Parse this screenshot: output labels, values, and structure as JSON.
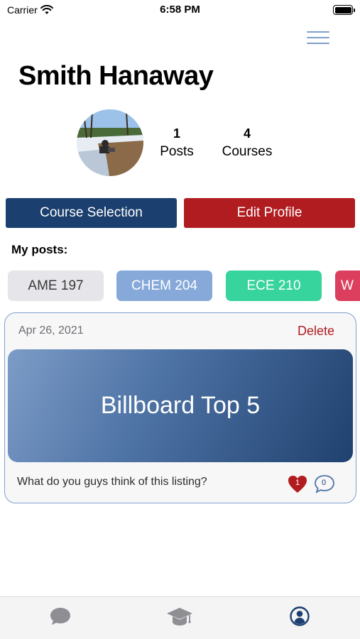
{
  "status_bar": {
    "carrier": "Carrier",
    "time": "6:58 PM"
  },
  "profile": {
    "name": "Smith Hanaway",
    "posts_count": "1",
    "posts_label": "Posts",
    "courses_count": "4",
    "courses_label": "Courses"
  },
  "actions": {
    "course_selection_label": "Course Selection",
    "edit_profile_label": "Edit Profile"
  },
  "my_posts": {
    "title": "My posts:",
    "chips": [
      {
        "label": "AME 197",
        "color": "#e5e5ea"
      },
      {
        "label": "CHEM 204",
        "color": "#86a9da"
      },
      {
        "label": "ECE 210",
        "color": "#37d49e"
      },
      {
        "label": "W",
        "color": "#dc3f5e"
      }
    ]
  },
  "post": {
    "date": "Apr 26, 2021",
    "delete_label": "Delete",
    "title": "Billboard Top 5",
    "caption": "What do you guys think of this listing?",
    "likes": "1",
    "comments": "0"
  },
  "tab_bar": {
    "items": [
      {
        "icon": "chat-bubble-icon",
        "active": false
      },
      {
        "icon": "graduation-cap-icon",
        "active": false
      },
      {
        "icon": "person-circle-icon",
        "active": true
      }
    ]
  },
  "colors": {
    "accent_blue": "#1b3f6e",
    "accent_red": "#b01c1f",
    "card_border": "#7f9fcc"
  }
}
